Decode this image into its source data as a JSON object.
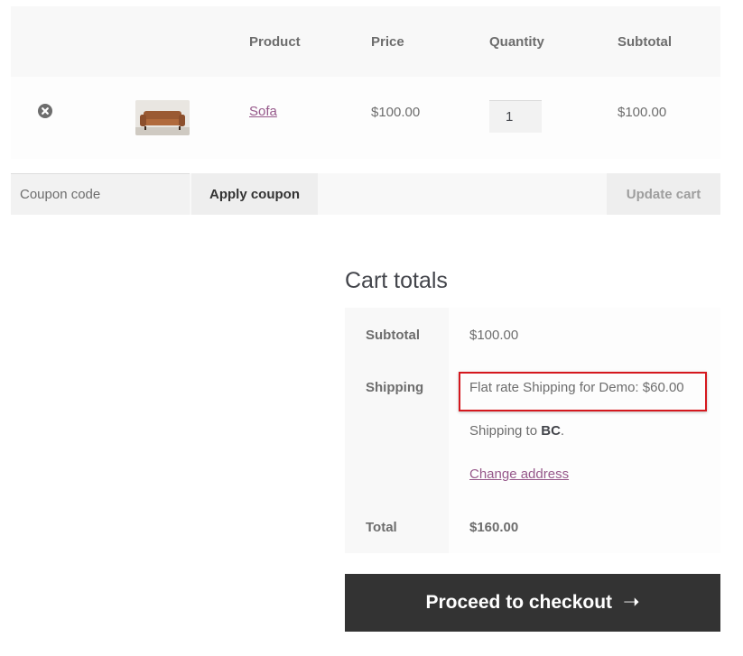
{
  "cart": {
    "headers": {
      "product": "Product",
      "price": "Price",
      "quantity": "Quantity",
      "subtotal": "Subtotal"
    },
    "items": [
      {
        "name": "Sofa",
        "thumbnail": "sofa-thumbnail",
        "price": "$100.00",
        "quantity": "1",
        "subtotal": "$100.00"
      }
    ],
    "remove_icon": "remove-circle-x-icon"
  },
  "actions": {
    "coupon_placeholder": "Coupon code",
    "apply_coupon_label": "Apply coupon",
    "update_cart_label": "Update cart"
  },
  "totals": {
    "heading": "Cart totals",
    "subtotal_label": "Subtotal",
    "subtotal_value": "$100.00",
    "shipping_label": "Shipping",
    "shipping_method": "Flat rate Shipping for Demo: $60.00",
    "shipping_to_prefix": "Shipping to",
    "shipping_region": "BC",
    "shipping_to_suffix": ".",
    "change_address_label": "Change address",
    "total_label": "Total",
    "total_value": "$160.00"
  },
  "checkout": {
    "label": "Proceed to checkout",
    "icon": "right-arrow-icon"
  },
  "colors": {
    "link": "#96588a",
    "checkout_bg": "#333333",
    "highlight_border": "#d5181e",
    "header_bg": "#f8f8f8"
  }
}
